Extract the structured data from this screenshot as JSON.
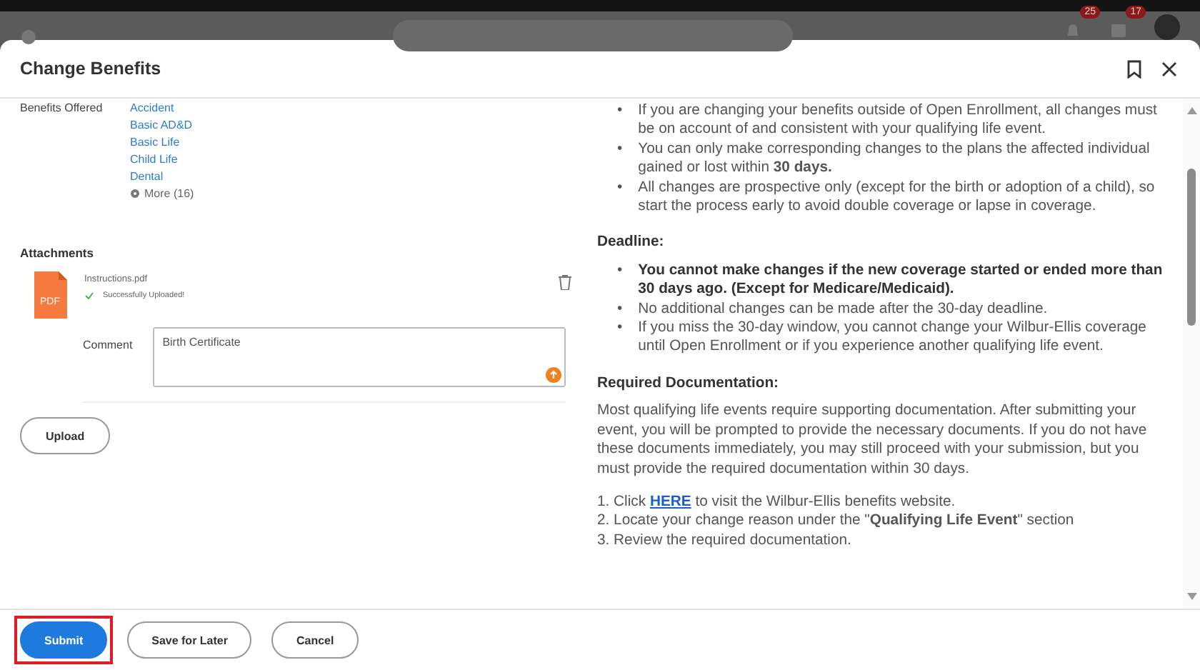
{
  "app_header": {
    "notifications_badge": "25",
    "inbox_badge": "17"
  },
  "dialog": {
    "title": "Change Benefits"
  },
  "benefits": {
    "label": "Benefits Offered",
    "links": [
      "Accident",
      "Basic AD&D",
      "Basic Life",
      "Child Life",
      "Dental"
    ],
    "more": "More (16)"
  },
  "attachments": {
    "title": "Attachments",
    "file_name": "Instructions.pdf",
    "file_type": "PDF",
    "status": "Successfully Uploaded!",
    "comment_label": "Comment",
    "comment_value": "Birth Certificate",
    "upload_button": "Upload"
  },
  "info": [
    {
      "kind": "bullets",
      "marker": "•",
      "items": [
        {
          "text": "If you are changing your benefits outside of Open Enrollment, all changes must be on account of and consistent with your qualifying life event.",
          "bold": false
        },
        {
          "text": "You can only make corresponding changes to the plans the affected individual gained or lost within **30 days.**",
          "bold": false
        },
        {
          "text": "All changes are prospective only (except for the birth or adoption of a child), so start the process early to avoid double coverage or lapse in coverage.",
          "bold": false
        }
      ]
    },
    {
      "kind": "heading",
      "text": "Deadline:"
    },
    {
      "kind": "bullets",
      "marker": "•",
      "items": [
        {
          "text": "You cannot make changes if the new coverage started or ended more than 30 days ago. (Except for Medicare/Medicaid).",
          "bold": true
        },
        {
          "text": "No additional changes can be made after the 30-day deadline.",
          "bold": false
        },
        {
          "text": "If you miss the 30-day window, you cannot change your Wilbur-Ellis coverage until Open Enrollment or if you experience another qualifying life event.",
          "bold": false
        }
      ]
    },
    {
      "kind": "heading",
      "text": "Required Documentation:"
    },
    {
      "kind": "paragraph",
      "text": "Most qualifying life events require supporting documentation. After submitting your event, you will be prompted to provide the necessary documents. If you do not have these documents immediately, you may still proceed with your submission, but you must provide the required documentation within 30 days."
    },
    {
      "kind": "steps",
      "items": [
        {
          "before": "1. Click",
          "link": "HERE",
          "after": "to visit the Wilbur-Ellis benefits website."
        },
        {
          "text": "2. Locate your change reason under the \"**Qualifying Life Event**\" section"
        },
        {
          "text": "3. Review the required documentation."
        }
      ]
    }
  ],
  "footer": {
    "buttons": [
      {
        "label": "Submit",
        "kind": "primary",
        "highlighted": true
      },
      {
        "label": "Save for Later",
        "kind": "secondary",
        "highlighted": false
      },
      {
        "label": "Cancel",
        "kind": "secondary",
        "highlighted": false
      }
    ]
  }
}
